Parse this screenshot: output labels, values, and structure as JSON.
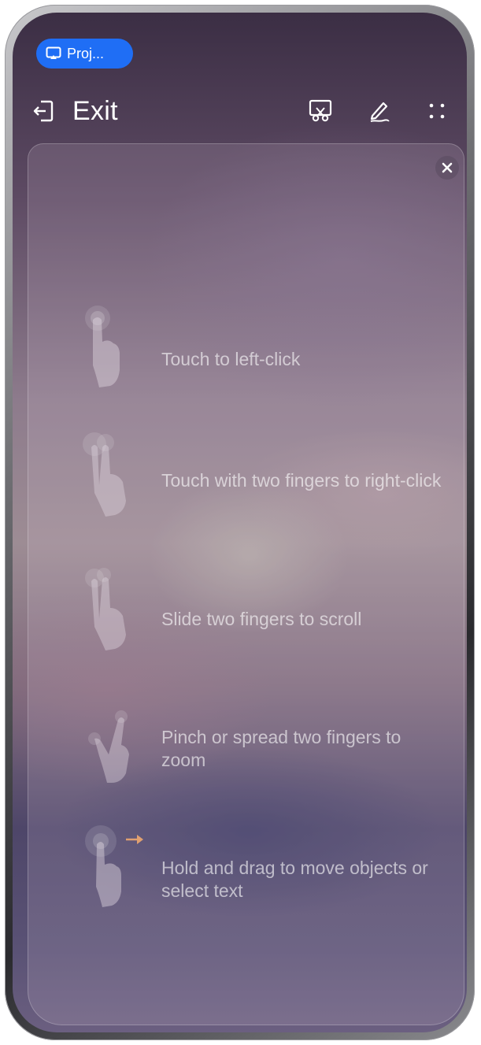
{
  "status_chip": {
    "label": "Proj...",
    "icon": "projection-icon",
    "color": "#1f6ef5"
  },
  "top_bar": {
    "exit_label": "Exit",
    "exit_icon": "exit-icon",
    "right_icons": [
      "screenshot-scissors-icon",
      "pen-annotate-icon",
      "more-dots-icon"
    ]
  },
  "overlay": {
    "close_icon": "close-icon",
    "gestures": [
      {
        "text": "Touch to left-click",
        "icon": "single-finger-tap-icon"
      },
      {
        "text": "Touch with two fingers to right-click",
        "icon": "two-finger-tap-icon"
      },
      {
        "text": "Slide two fingers to scroll",
        "icon": "two-finger-slide-icon"
      },
      {
        "text": "Pinch or spread two fingers to zoom",
        "icon": "pinch-zoom-icon"
      },
      {
        "text": "Hold and drag to move objects or select text",
        "icon": "hold-drag-icon"
      }
    ]
  },
  "colors": {
    "accent": "#1f6ef5",
    "hint_text": "rgba(255,255,255,0.6)"
  }
}
